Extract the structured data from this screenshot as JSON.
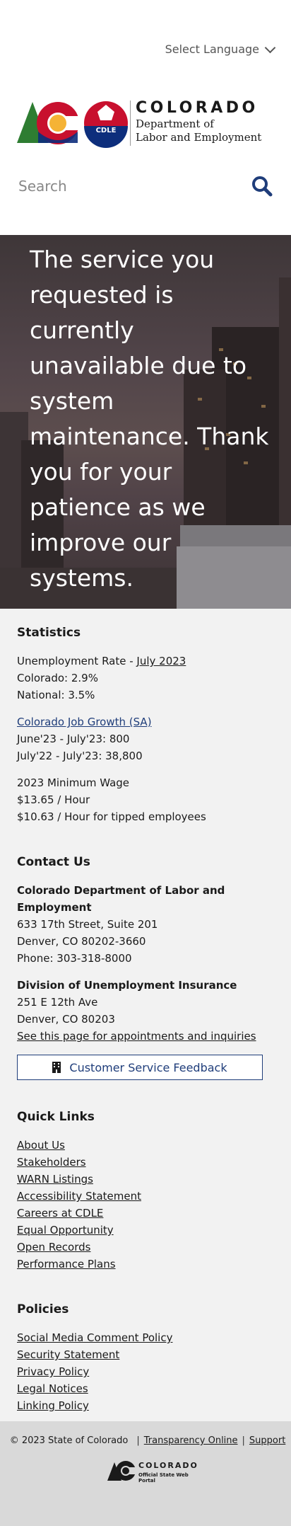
{
  "header": {
    "language_label": "Select Language",
    "wordmark": {
      "state": "COLORADO",
      "dept_line1": "Department of",
      "dept_line2": "Labor and Employment"
    },
    "logo_badge": "CDLE",
    "search": {
      "placeholder": "Search"
    }
  },
  "hero": {
    "message": "The service you requested is currently unavailable due to system maintenance. Thank you for your patience as we improve our systems."
  },
  "statistics": {
    "title": "Statistics",
    "unemployment_prefix": "Unemployment Rate - ",
    "unemployment_month_link": "July 2023",
    "colorado_rate": "Colorado: 2.9%",
    "national_rate": "National: 3.5%",
    "job_growth_link": "Colorado Job Growth (SA)",
    "job_growth_1": "June'23 - July'23: 800",
    "job_growth_2": "July'22 - July'23: 38,800",
    "min_wage_title": "2023 Minimum Wage",
    "min_wage_hour": "$13.65 / Hour",
    "min_wage_tipped": "$10.63 / Hour for tipped employees"
  },
  "contact": {
    "title": "Contact Us",
    "org_name": "Colorado Department of Labor and Employment",
    "org_address1": "633 17th Street, Suite 201",
    "org_address2": "Denver, CO  80202-3660",
    "org_phone": "Phone: 303-318-8000",
    "div_name": "Division of Unemployment Insurance",
    "div_address1": "251 E 12th Ave",
    "div_address2": "Denver, CO  80203",
    "div_link": "See this page for appointments and inquiries",
    "feedback_button": "Customer Service Feedback"
  },
  "quick_links": {
    "title": "Quick Links",
    "items": [
      "About Us",
      "Stakeholders",
      "WARN Listings",
      "Accessibility Statement",
      "Careers at CDLE",
      "Equal Opportunity",
      "Open Records",
      "Performance Plans"
    ]
  },
  "policies": {
    "title": "Policies",
    "items": [
      "Social Media Comment Policy",
      "Security Statement",
      "Privacy Policy",
      "Legal Notices",
      "Linking Policy"
    ]
  },
  "bottom": {
    "copyright": "© 2023 State of Colorado",
    "transparency": "Transparency Online",
    "support": "Support",
    "state_logo_title": "COLORADO",
    "state_logo_sub": "Official State Web Portal"
  },
  "colors": {
    "accent_blue": "#1f3d7a",
    "logo_red": "#c8102e",
    "logo_gold": "#f5b335",
    "logo_green": "#2e7d32",
    "logo_blue": "#0d2e7c"
  }
}
